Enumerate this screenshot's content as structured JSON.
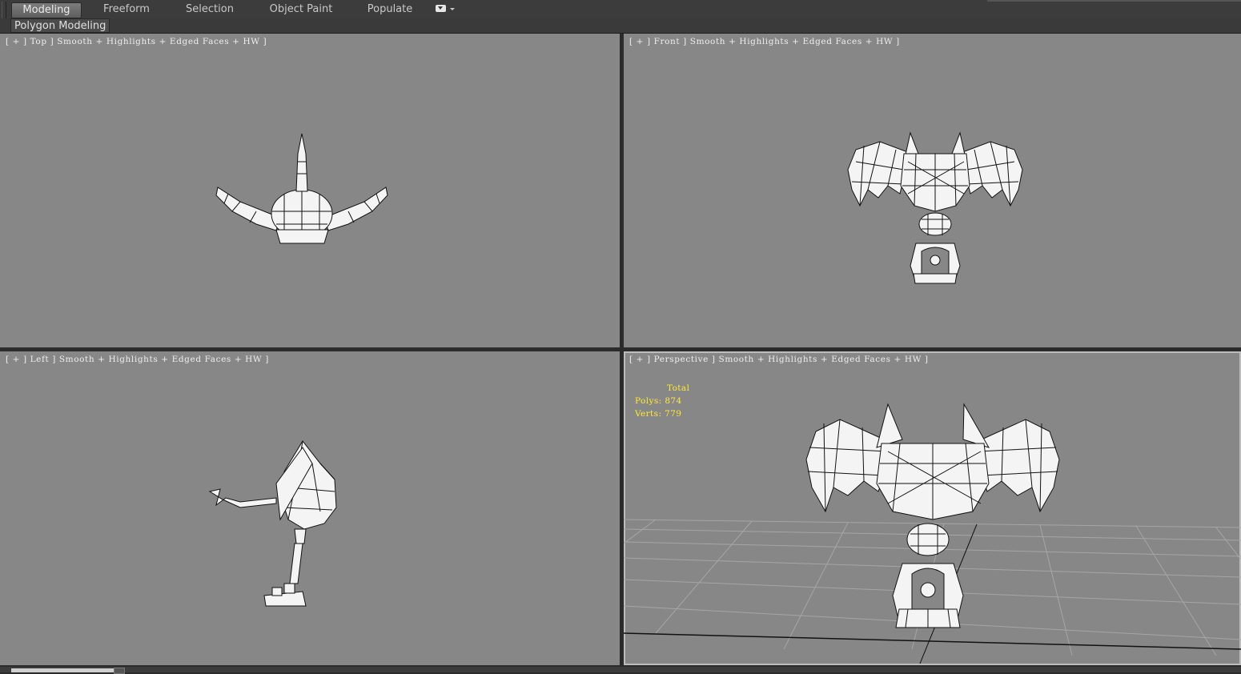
{
  "ribbon": {
    "tabs": [
      {
        "label": "Modeling",
        "active": true
      },
      {
        "label": "Freeform",
        "active": false
      },
      {
        "label": "Selection",
        "active": false
      },
      {
        "label": "Object Paint",
        "active": false
      },
      {
        "label": "Populate",
        "active": false
      }
    ],
    "panel_label": "Polygon Modeling"
  },
  "viewports": {
    "top": {
      "label": "[ + ] Top ] Smooth + Highlights + Edged Faces + HW ]"
    },
    "front": {
      "label": "[ + ] Front ] Smooth + Highlights + Edged Faces + HW ]"
    },
    "left": {
      "label": "[ + ] Left ] Smooth + Highlights + Edged Faces + HW ]"
    },
    "perspective": {
      "label": "[ + ] Perspective ] Smooth + Highlights + Edged Faces + HW ]"
    }
  },
  "stats": {
    "heading": "Total",
    "polys": "Polys: 874",
    "verts": "Verts: 779"
  },
  "colors": {
    "viewport_bg": "#878787",
    "stats_text": "#ffeb2a",
    "label_text": "#eeeeee"
  }
}
